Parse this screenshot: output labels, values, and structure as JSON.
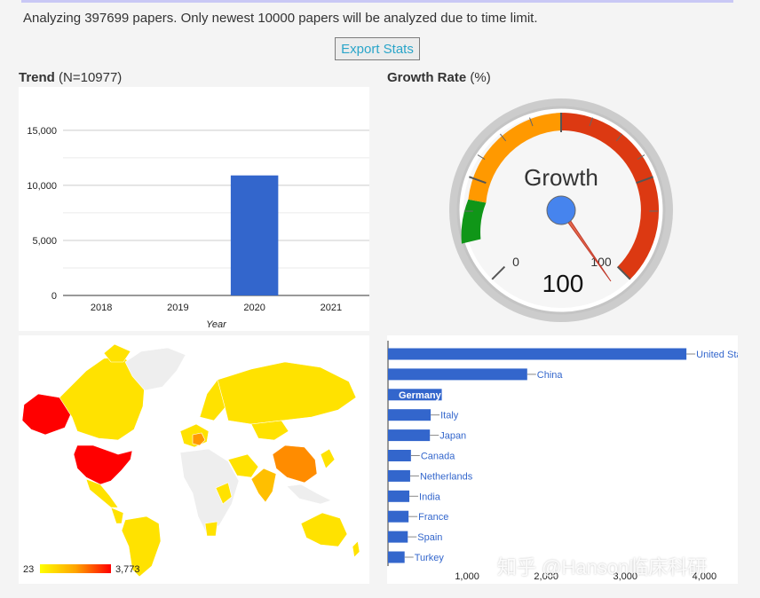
{
  "header": {
    "analysis_text": "Analyzing 397699 papers. Only newest 10000 papers will be analyzed due to time limit.",
    "export_label": "Export Stats"
  },
  "trend": {
    "title_bold": "Trend",
    "title_rest": " (N=10977)"
  },
  "growth": {
    "title_bold": "Growth Rate",
    "title_rest": " (%)",
    "gauge_label": "Growth",
    "gauge_value": "100",
    "value": 100,
    "min_label": "0",
    "max_label": "100"
  },
  "map_legend": {
    "min": "23",
    "max": "3,773"
  },
  "watermark": "知乎 @Hanson临床科研",
  "colors": {
    "bar": "#3366cc",
    "gauge_green": "#109618",
    "gauge_orange": "#ff9900",
    "gauge_red": "#dc3912"
  },
  "chart_data": [
    {
      "type": "bar",
      "categories": [
        "2018",
        "2019",
        "2020",
        "2021"
      ],
      "values": [
        0,
        0,
        10900,
        0
      ],
      "xlabel": "Year",
      "ylabel": "",
      "ylim": [
        0,
        17000
      ],
      "yticks": [
        "0",
        "5,000",
        "10,000",
        "15,000"
      ],
      "grid": true
    },
    {
      "type": "bar",
      "orientation": "horizontal",
      "categories": [
        "United Sta",
        "China",
        "Germany",
        "Italy",
        "Japan",
        "Canada",
        "Netherlands",
        "India",
        "France",
        "Spain",
        "Turkey"
      ],
      "values": [
        3773,
        1760,
        680,
        540,
        530,
        290,
        280,
        270,
        260,
        250,
        210
      ],
      "xticks": [
        "1,000",
        "2,000",
        "3,000",
        "4,000"
      ],
      "xlim": [
        0,
        4400
      ]
    }
  ]
}
